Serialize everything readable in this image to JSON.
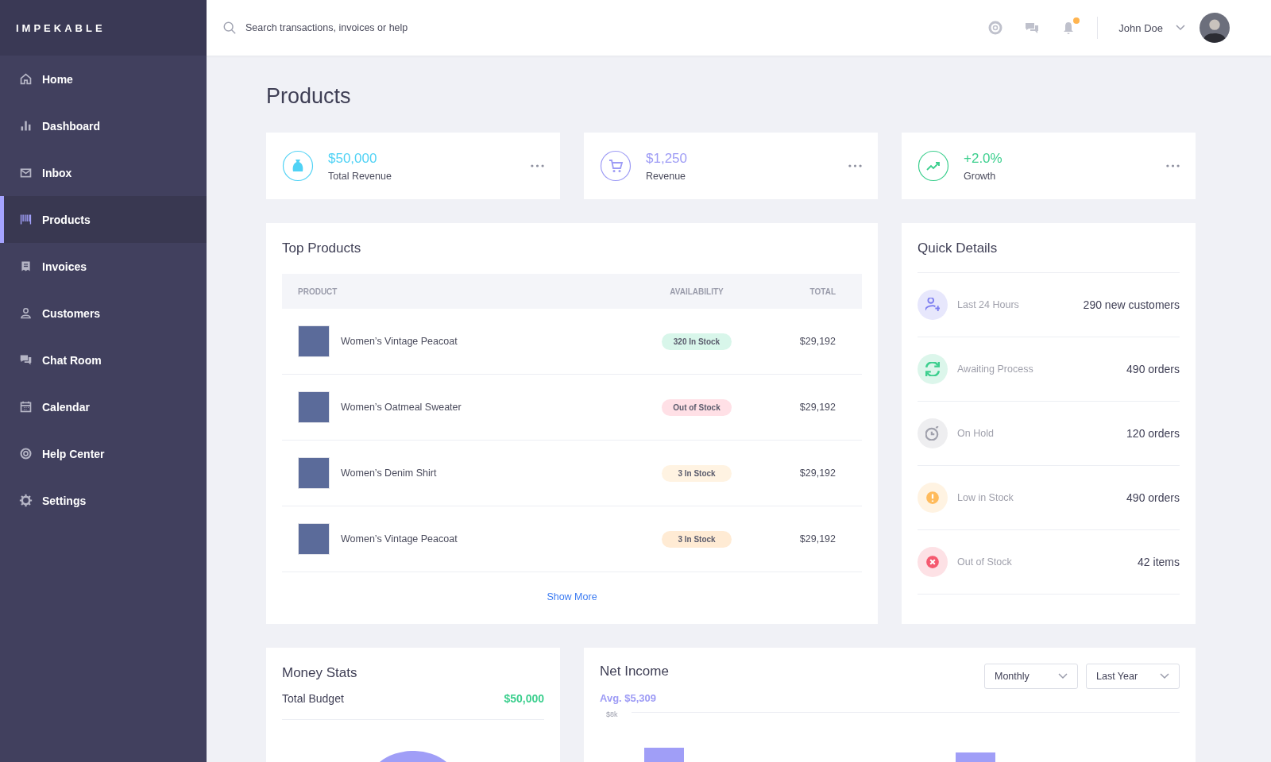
{
  "brand": "IMPEKABLE",
  "sidebar": {
    "items": [
      {
        "label": "Home",
        "kind": "home",
        "selected": false
      },
      {
        "label": "Dashboard",
        "kind": "bars",
        "selected": false
      },
      {
        "label": "Inbox",
        "kind": "mail",
        "selected": false
      },
      {
        "label": "Products",
        "kind": "barcode",
        "selected": true
      },
      {
        "label": "Invoices",
        "kind": "receipt",
        "selected": false
      },
      {
        "label": "Customers",
        "kind": "user",
        "selected": false
      },
      {
        "label": "Chat Room",
        "kind": "chat",
        "selected": false
      },
      {
        "label": "Calendar",
        "kind": "calendar",
        "selected": false
      },
      {
        "label": "Help Center",
        "kind": "help",
        "selected": false
      },
      {
        "label": "Settings",
        "kind": "gear",
        "selected": false
      }
    ]
  },
  "search": {
    "placeholder": "Search transactions, invoices or help"
  },
  "topbar": {
    "notifications_unread": true,
    "user_name": "John Doe"
  },
  "page_title": "Products",
  "stats": [
    {
      "kind": "bag",
      "value": "$50,000",
      "label": "Total Revenue",
      "color": "#4fd2f5"
    },
    {
      "kind": "cart",
      "value": "$1,250",
      "label": "Revenue",
      "color": "#9d9bf5"
    },
    {
      "kind": "trend",
      "value": "+2.0%",
      "label": "Growth",
      "color": "#3ccf8e"
    }
  ],
  "top_products": {
    "title": "Top Products",
    "columns": [
      "PRODUCT",
      "AVAILABILITY",
      "TOTAL"
    ],
    "rows": [
      {
        "product": "Women’s Vintage Peacoat",
        "availability": "320 In Stock",
        "color": "#d8f6ea",
        "total": "$29,192"
      },
      {
        "product": "Women’s Oatmeal Sweater",
        "availability": "Out of Stock",
        "color": "#ffe0e6",
        "total": "$29,192"
      },
      {
        "product": "Women’s Denim Shirt",
        "availability": "3 In Stock",
        "color": "#fff3e2",
        "total": "$29,192"
      },
      {
        "product": "Women’s Vintage Peacoat",
        "availability": "3 In Stock",
        "color": "#ffebd4",
        "total": "$29,192"
      }
    ],
    "show_more": "Show More"
  },
  "quick_details": {
    "title": "Quick Details",
    "items": [
      {
        "kind": "user-add",
        "label": "Last 24 Hours",
        "value": "290 new customers",
        "color": "#7b7cf0"
      },
      {
        "kind": "refresh",
        "label": "Awaiting Process",
        "value": "490 orders",
        "color": "#3ccf8e"
      },
      {
        "kind": "timer",
        "label": "On Hold",
        "value": "120 orders",
        "color": "#a0a1ac"
      },
      {
        "kind": "alert",
        "label": "Low in Stock",
        "value": "490 orders",
        "color": "#ffbb5c"
      },
      {
        "kind": "cross",
        "label": "Out of Stock",
        "value": "42 items",
        "color": "#f5596f"
      }
    ]
  },
  "money_stats": {
    "title": "Money Stats",
    "budget_label": "Total Budget",
    "budget_value": "$50,000"
  },
  "net_income": {
    "title": "Net Income",
    "average": "Avg. $5,309",
    "filters": [
      "Monthly",
      "Last Year"
    ],
    "tick": "$8k"
  }
}
